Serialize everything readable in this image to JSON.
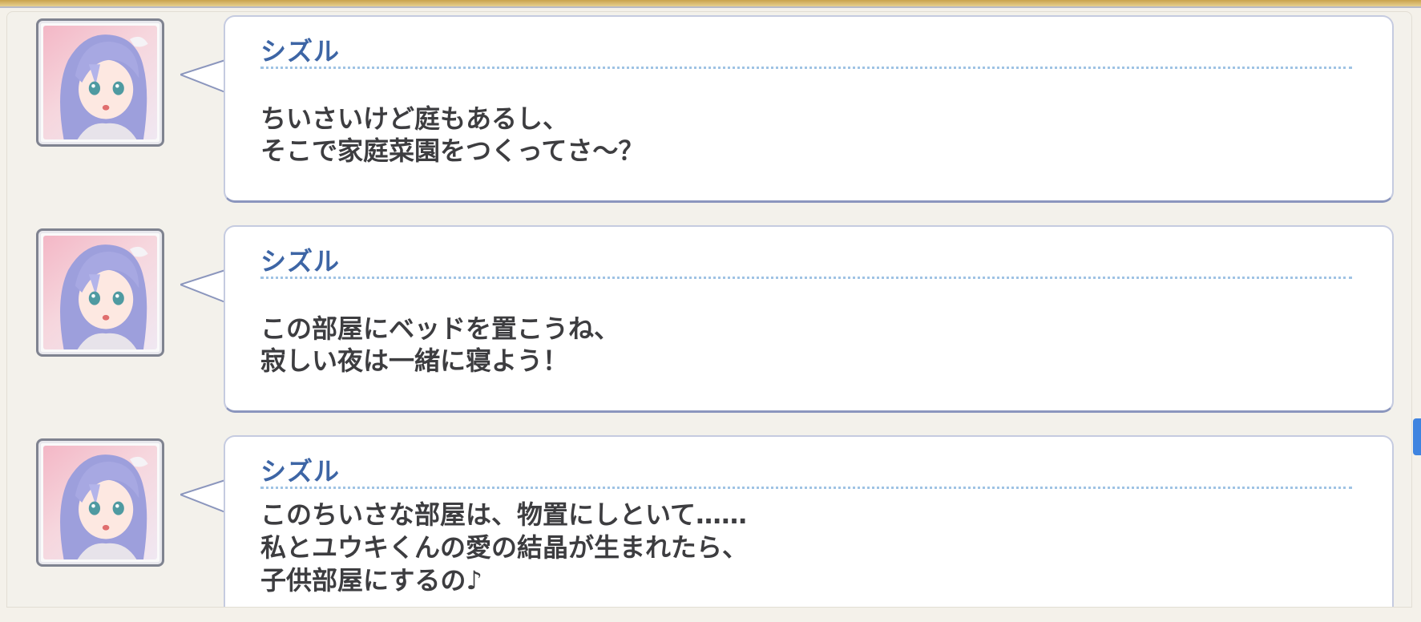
{
  "messages": [
    {
      "speaker": "シズル",
      "lines": [
        "ちいさいけど庭もあるし、",
        "そこで家庭菜園をつくってさ～？"
      ]
    },
    {
      "speaker": "シズル",
      "lines": [
        "この部屋にベッドを置こうね、",
        "寂しい夜は一緒に寝よう！"
      ]
    },
    {
      "speaker": "シズル",
      "lines": [
        "このちいさな部屋は、物置にしといて……",
        "私とユウキくんの愛の結晶が生まれたら、",
        "子供部屋にするの♪"
      ]
    }
  ],
  "colors": {
    "speaker": "#3d65a5",
    "text": "#3d3d40",
    "divider": "#9fc3e4",
    "scrollbar": "#3f84e0"
  },
  "icons": {
    "portrait": "character-portrait-shizuru",
    "scroll": "scrollbar-thumb"
  }
}
